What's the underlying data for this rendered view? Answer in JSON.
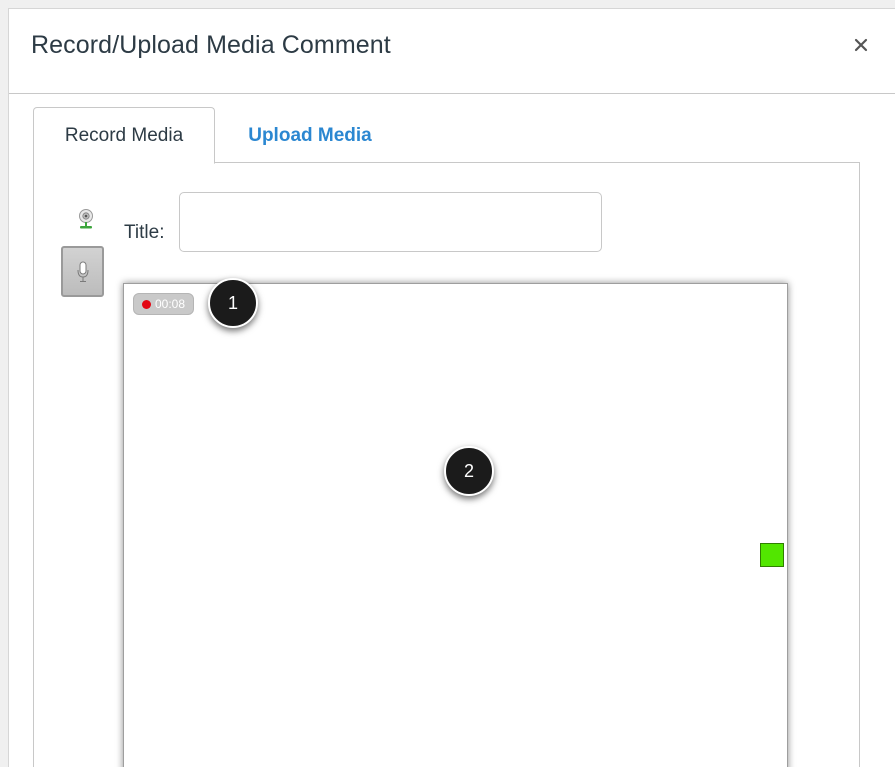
{
  "dialog": {
    "title": "Record/Upload Media Comment",
    "close_icon": "close-icon"
  },
  "tabs": [
    {
      "label": "Record Media",
      "active": true
    },
    {
      "label": "Upload Media",
      "active": false
    }
  ],
  "record": {
    "title_label": "Title:",
    "title_value": "",
    "webcam_icon": "webcam-icon",
    "mic_icon": "microphone-icon",
    "recording": {
      "timer": "00:08",
      "indicator_color": "#e30613"
    },
    "level_indicator_color": "#52e600"
  },
  "callouts": [
    "1",
    "2"
  ],
  "colors": {
    "link": "#2b87d1",
    "text": "#2d3b45"
  }
}
